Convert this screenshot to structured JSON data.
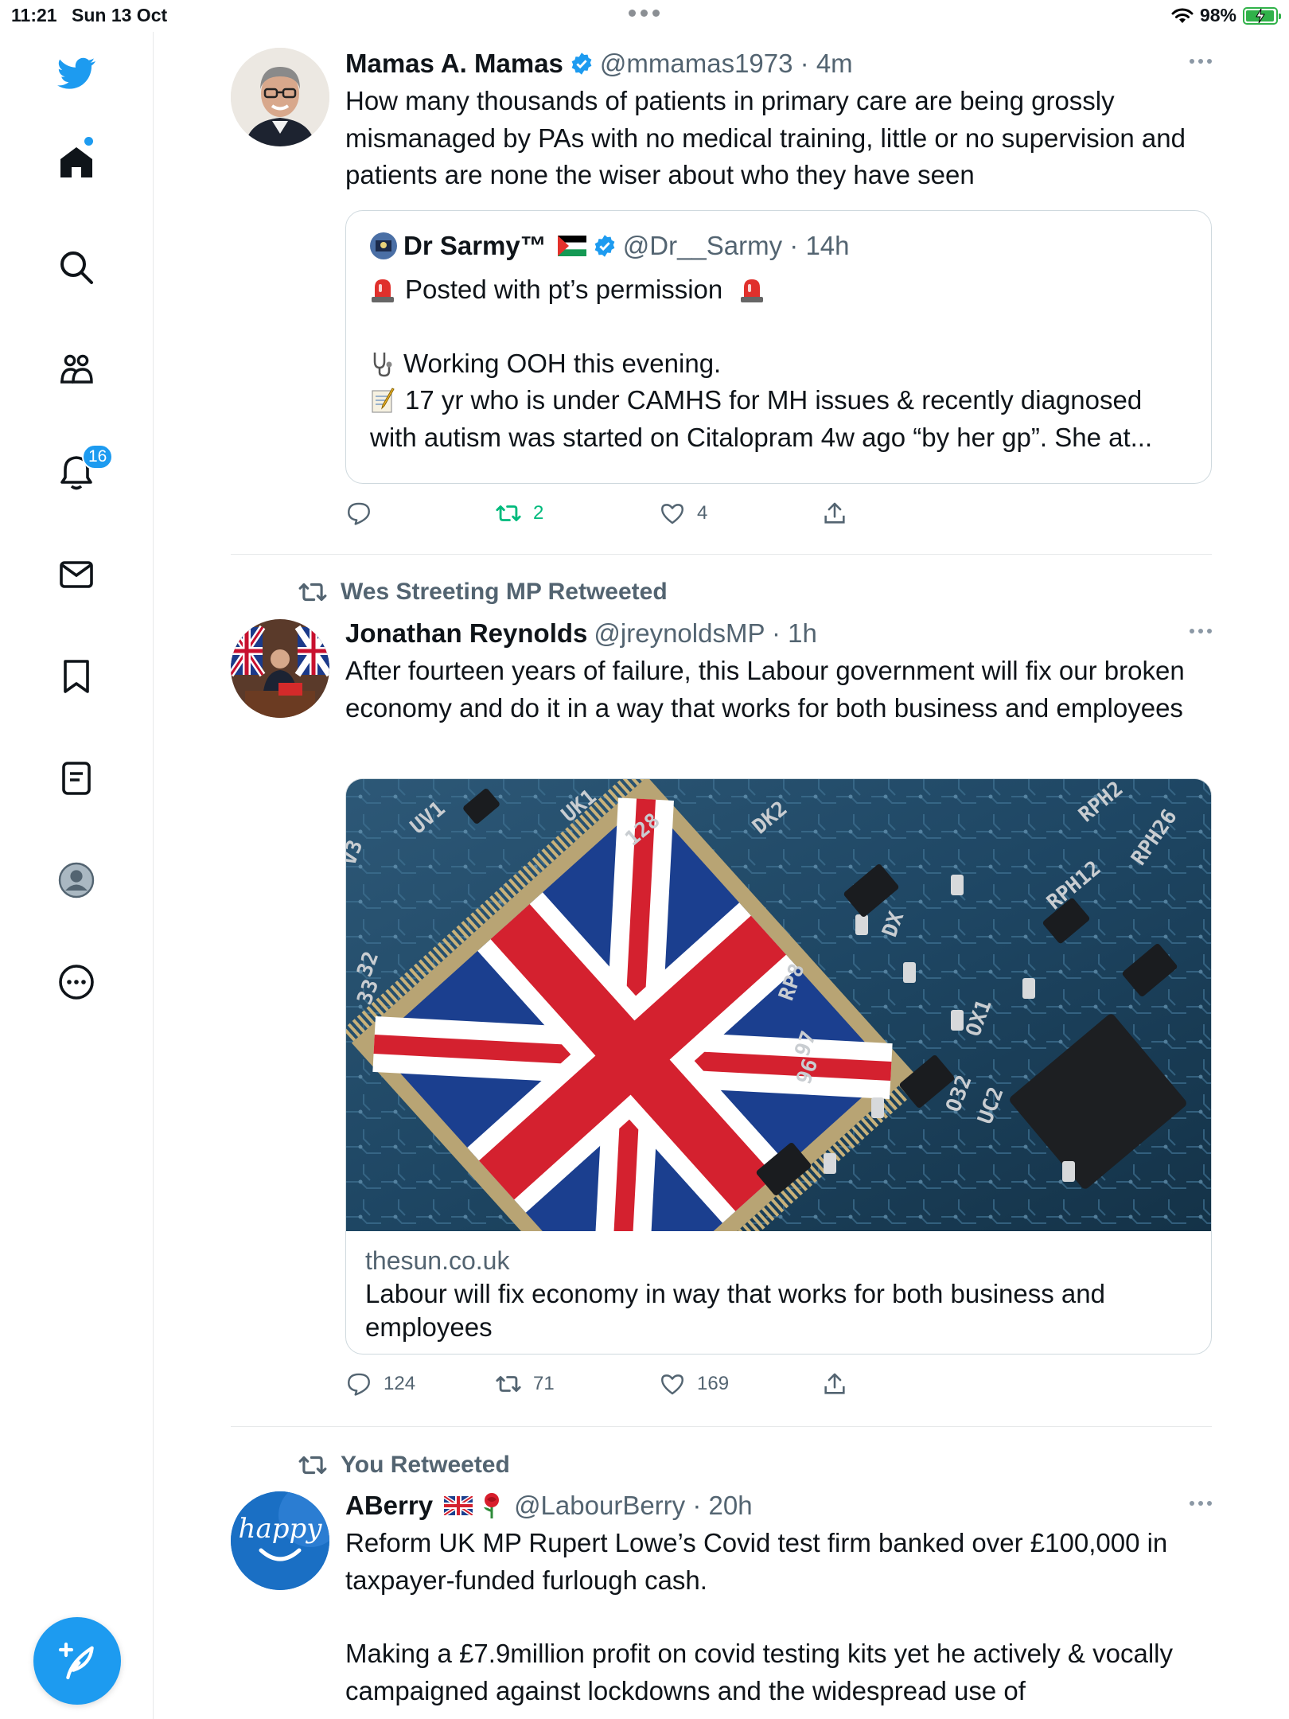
{
  "status": {
    "time": "11:21",
    "date": "Sun 13 Oct",
    "battery": "98%"
  },
  "sidebar": {
    "notifications_count": "16",
    "items": [
      "twitter-logo",
      "home-icon",
      "search-icon",
      "communities-icon",
      "notifications-icon",
      "messages-icon",
      "bookmarks-icon",
      "lists-icon",
      "profile-icon",
      "more-icon"
    ]
  },
  "tweets": [
    {
      "name": "Mamas A. Mamas",
      "handle": "@mmamas1973 · 4m",
      "text": "How many thousands of patients in primary care are being grossly mismanaged by PAs with no medical training, little or no supervision and patients are none the wiser about who they have seen",
      "quote": {
        "name": "Dr Sarmy™",
        "handle": "@Dr__Sarmy · 14h",
        "line1": "Posted with pt’s permission",
        "line2": "Working OOH this evening.",
        "line3": "17 yr who is under CAMHS for MH issues & recently diagnosed with autism was started on Citalopram 4w ago “by her gp”. She at..."
      },
      "replies": "",
      "retweets": "2",
      "likes": "4"
    },
    {
      "retweeted_by": "Wes Streeting MP Retweeted",
      "name": "Jonathan Reynolds",
      "handle": "@jreynoldsMP · 1h",
      "text": "After fourteen years of failure, this Labour government will fix our broken economy and do it in a way that works for both business and employees",
      "card": {
        "domain": "thesun.co.uk",
        "title": "Labour will fix economy in way that works for both business and employees",
        "chip_labels": [
          "UV1",
          "UK1",
          "128",
          "DK2",
          "RPH2",
          "RPH26",
          "RPH12",
          "V3",
          "32",
          "33",
          "97",
          "96",
          "OX1",
          "O32",
          "UC2",
          "RP8",
          "DX"
        ]
      },
      "replies": "124",
      "retweets": "71",
      "likes": "169"
    },
    {
      "retweeted_by": "You Retweeted",
      "name": "ABerry",
      "handle": "@LabourBerry · 20h",
      "avatar_text": "happy",
      "text1": "Reform UK MP Rupert Lowe’s Covid test firm banked over £100,000 in taxpayer-funded furlough cash.",
      "text2": "Making a £7.9million profit on covid testing kits yet he actively & vocally campaigned against lockdowns and the widespread use of"
    }
  ],
  "colors": {
    "accent": "#1d9bf0",
    "retweet_green": "#00ba7c",
    "muted": "#536471"
  }
}
